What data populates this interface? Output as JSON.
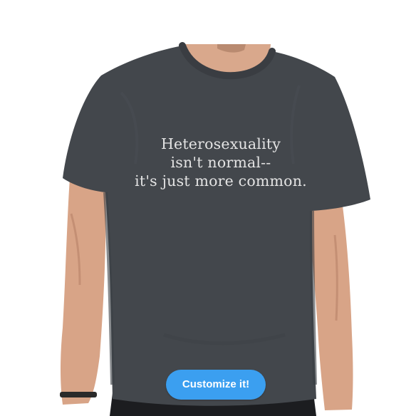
{
  "product": {
    "shirt_color": "#43474c",
    "print_lines": [
      "Heterosexuality",
      "isn't normal--",
      "it's just more common."
    ]
  },
  "actions": {
    "customize_label": "Customize it!",
    "accent_color": "#3b9ff0"
  }
}
